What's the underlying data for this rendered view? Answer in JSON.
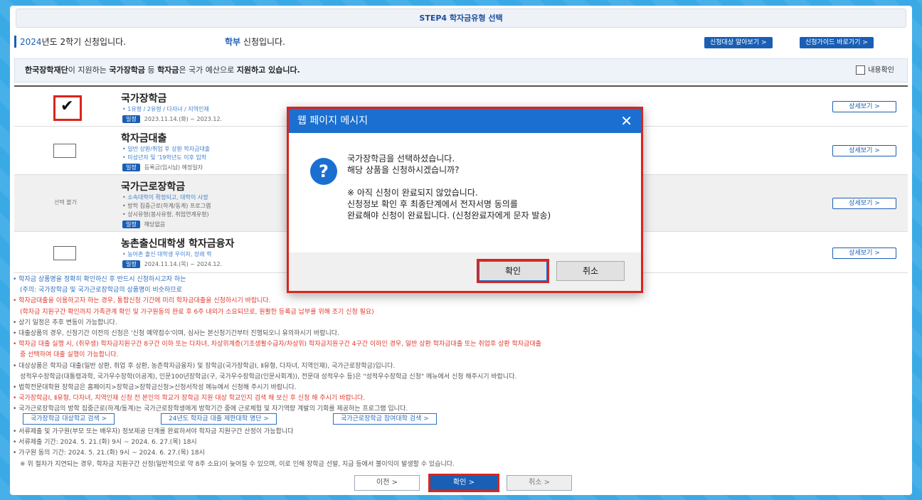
{
  "step_bar": "STEP4 학자금유형 선택",
  "info": {
    "year_prefix": "2024",
    "year_suffix": "년도 2학기 신청입니다.",
    "dept_bold": "학부",
    "dept_suffix": " 신청입니다."
  },
  "top_buttons": [
    "신청대상 알아보기 >",
    "신청가이드 바로가기 >"
  ],
  "notice": {
    "org": "한국장학재단",
    "text_a": "이 지원하는 ",
    "b1": "국가장학금",
    "text_b": " 등 ",
    "b2": "학자금",
    "text_c": "은 국가 예산으로 ",
    "b3": "지원하고 있습니다.",
    "agree_label": "내용확인"
  },
  "items": [
    {
      "title": "국가장학금",
      "line1": "• 1유형 / 2유형 / 다자녀 / 지역인재",
      "tag": "일정",
      "line2": "2023.11.14.(화) ~ 2023.12.",
      "detail": "상세보기 >",
      "checked": true
    },
    {
      "title": "학자금대출",
      "line1": "• 일반 상환/취업 후 상환 학자금대출",
      "line1b": "• 미성년자 및 '19학년도 이후 입학",
      "tag": "일정",
      "line2": "등록금(입시납) 예정일자",
      "detail": "상세보기 >",
      "checked": false
    },
    {
      "title": "국가근로장학금",
      "line1": "• 소속대학이 확정되고, 대학이 사정",
      "line1b": "• 방학 집중근로(하계/동계) 프로그램",
      "line1c": "• 상시유형(봉사유형, 취업연계유형)",
      "tag": "일정",
      "line2": "해당없음",
      "detail": "상세보기 >",
      "unavailable": "선택 불가"
    },
    {
      "title": "농촌출신대학생 학자금융자",
      "line1": "• 농어촌 출신 대학생 우이자, 장래 학",
      "tag": "일정",
      "line2": "2024.11.14.(목) ~ 2024.12.",
      "detail": "상세보기 >",
      "checked": false
    }
  ],
  "notes": [
    {
      "cls": "blue",
      "text": "• 학자금 상품명을 정확히 확인하신 후 반드시 신청하시고자 하는"
    },
    {
      "cls": "blue indent",
      "text": "(주의: 국가장학금 및 국가근로장학금의 상품명이 비슷하므로"
    },
    {
      "cls": "red",
      "text": "• 학자금대출을 이용하고자 하는 경우, 통합신청 기간에 미리 학자금대출을 신청하시기 바랍니다."
    },
    {
      "cls": "red indent",
      "text": "(학자금 지원구간 확인까지 가족관계 확인 및 가구원동의 완료 후 6주 내외가 소요되므로, 원활한 등록금 납부를 위해 조기 신청 필요)"
    },
    {
      "cls": "gray",
      "text": "• 상기 일정은 추후 변동이 가능합니다."
    },
    {
      "cls": "gray",
      "text": "• 대출상품의 경우, 신청기간 이전의 신청은 '신청 예약접수'이며, 심사는 본신청기간부터 진행되오니 유의하시기 바랍니다."
    },
    {
      "cls": "red",
      "text": "• 학자금 대출 실행 시, (취우생) 학자금지원구간 8구간 이하 또는 다자녀, 차상위계층(기초생활수급자/차상위) 학자금지원구간 4구간 이하인 경우, 일반 상환 학자금대출 또는 취업후 상환 학자금대출"
    },
    {
      "cls": "red indent",
      "text": "중 선택하여 대출 실행이 가능합니다."
    },
    {
      "cls": "gray",
      "text": "• 대상상품은 학자금 대출(일반 상환, 취업 후 상환, 농촌학자금융자) 및 장학금(국가장학금Ⅰ, Ⅱ유형, 다자녀, 지역인재), 국가근로장학금)입니다."
    },
    {
      "cls": "gray indent",
      "text": "성적우수장학금(대통령과학, 국가우수장학(이공계), 인문100년장학금(구, 국가우수장학금(인문사회계)), 전문대 성적우수 등)은 \"성적우수장학금 신청\" 메뉴에서 신청 해주시기 바랍니다."
    },
    {
      "cls": "gray",
      "text": "• 법학전문대학원 장학금은 홈페이지>장학금>장학금신청>신청서작성 메뉴에서 신청해 주시기 바랍니다."
    },
    {
      "cls": "red",
      "text": "• 국가장학금Ⅰ, Ⅱ유형, 다자녀, 지역인재 신청 전 본인의 학교가 장학금 지원 대상 학교인지 검색 해 보신 후 신청 해 주시기 바랍니다."
    },
    {
      "cls": "gray",
      "text": "• 국가근로장학금의 방학 집중근로(하계/동계)는 국가근로장학생에게 방학기간 중에 근로체험 및 자기역량 계발의 기회를 제공하는 프로그램 입니다."
    }
  ],
  "links": [
    "국가장학금 대상학교 검색 >",
    "24년도 학자금 대출 제한대학 명단 >",
    "국가근로장학금 참여대학 검색 >"
  ],
  "notes2": [
    {
      "cls": "gray",
      "text": "• 서류제출 및 가구원(부모 또는 배우자) 정보제공 단계를 완료하셔야 학자금 지원구간 산정이 가능합니다"
    },
    {
      "cls": "gray",
      "text": "• 서류제출 기간: 2024. 5. 21.(화) 9시 ~ 2024. 6. 27.(목) 18시"
    },
    {
      "cls": "gray",
      "text": "• 가구원 동의 기간: 2024. 5. 21.(화) 9시 ~ 2024. 6. 27.(목) 18시"
    },
    {
      "cls": "gray indent",
      "text": "※ 위 절차가 지연되는 경우, 학자금 지원구간 산정(일반적으로 약 8주 소요)이 늦어질 수 있으며, 이로 인해 장학금 선발, 지급 등에서 불이익이 발생할 수 있습니다."
    }
  ],
  "bottom": {
    "prev": "이전 >",
    "confirm": "확인 >",
    "cancel": "취소 >"
  },
  "dialog": {
    "title": "웹 페이지 메시지",
    "close": "✕",
    "icon": "?",
    "lines": [
      "국가장학금을 선택하셨습니다.",
      "해당 상품을 신청하시겠습니까?",
      "",
      "※ 아직 신청이 완료되지 않았습니다.",
      "신청정보 확인 후 최종단계에서 전자서명 동의를",
      "완료해야 신청이 완료됩니다. (신청완료자에게 문자 발송)"
    ],
    "ok": "확인",
    "cancel": "취소"
  }
}
